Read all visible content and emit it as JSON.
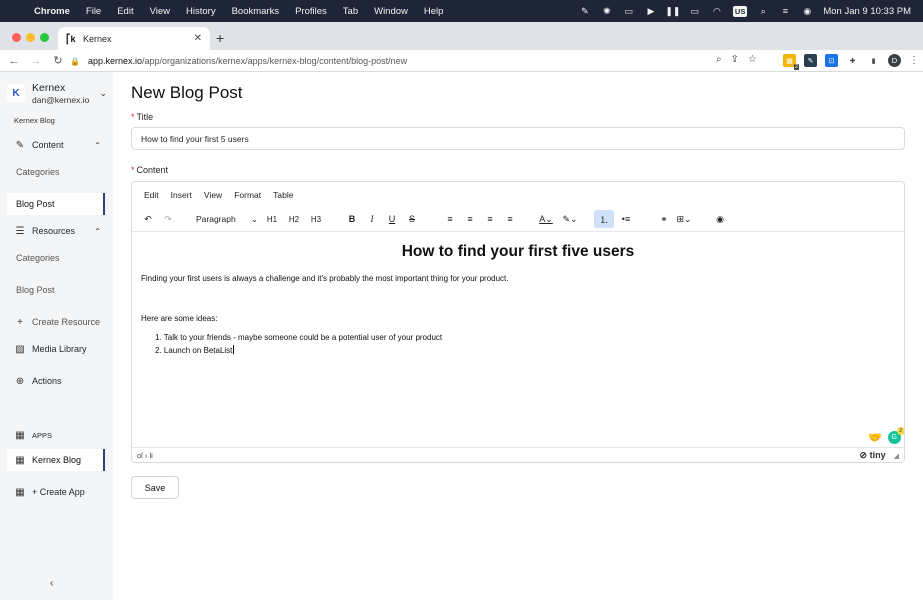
{
  "menubar": {
    "app": "Chrome",
    "items": [
      "File",
      "Edit",
      "View",
      "History",
      "Bookmarks",
      "Profiles",
      "Tab",
      "Window",
      "Help"
    ],
    "input_source": "US",
    "clock": "Mon Jan 9  10:33 PM"
  },
  "browser": {
    "tab_title": "Kernex",
    "url_host": "app.kernex.io",
    "url_path": "/app/organizations/kernex/apps/kernex-blog/content/blog-post/new",
    "profile_initial": "D",
    "ext_badge": "2"
  },
  "sidebar": {
    "org_initial": "K",
    "org_name": "Kernex",
    "org_email": "dan@kernex.io",
    "app_label": "Kernex Blog",
    "content": "Content",
    "content_items": [
      "Categories",
      "Blog Post"
    ],
    "resources": "Resources",
    "resource_items": [
      "Categories",
      "Blog Post"
    ],
    "create_resource": "Create Resource",
    "media_library": "Media Library",
    "actions": "Actions",
    "apps_label": "APPS",
    "app_item": "Kernex Blog",
    "create_app": "+ Create App"
  },
  "page": {
    "title": "New Blog Post",
    "title_label": "Title",
    "title_value": "How to find your first 5 users",
    "content_label": "Content",
    "save": "Save"
  },
  "editor": {
    "menus": [
      "Edit",
      "Insert",
      "View",
      "Format",
      "Table"
    ],
    "block_format": "Paragraph",
    "headings": [
      "H1",
      "H2",
      "H3"
    ],
    "heading": "How to find your first five users",
    "paragraph1": "Finding your first users is always a challenge and it's probably the most important thing for your product.",
    "paragraph2": "Here are some ideas:",
    "list": [
      "1. Talk to your friends - maybe someone could be a potential user of your product",
      "2. Launch on BetaList"
    ],
    "path": "ol › li",
    "brand": "tiny",
    "grammarly_count": "2"
  }
}
